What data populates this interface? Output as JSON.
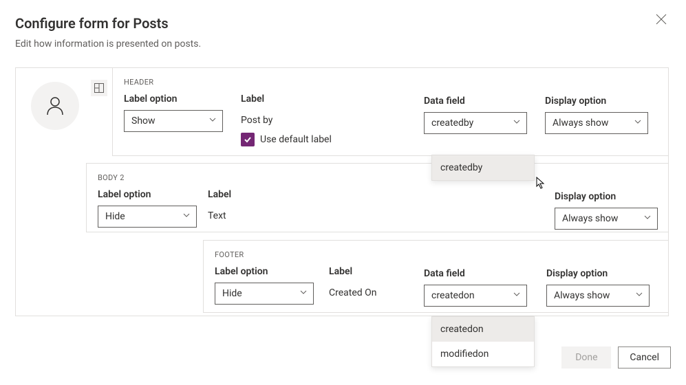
{
  "dialog": {
    "title": "Configure form for Posts",
    "subtitle": "Edit how information is presented on posts."
  },
  "labels": {
    "label_option": "Label option",
    "label": "Label",
    "data_field": "Data field",
    "display_option": "Display option",
    "use_default_label": "Use default label"
  },
  "header": {
    "tag": "HEADER",
    "label_option": "Show",
    "label": "Post by",
    "data_field": "createdby",
    "display_option": "Always show",
    "use_default_label_checked": true,
    "data_field_options": [
      "createdby"
    ]
  },
  "body2": {
    "tag": "BODY 2",
    "label_option": "Hide",
    "label": "Text",
    "display_option": "Always show"
  },
  "footer": {
    "tag": "FOOTER",
    "label_option": "Hide",
    "label": "Created On",
    "data_field": "createdon",
    "display_option": "Always show",
    "data_field_options": [
      "createdon",
      "modifiedon"
    ]
  },
  "buttons": {
    "done": "Done",
    "cancel": "Cancel"
  }
}
